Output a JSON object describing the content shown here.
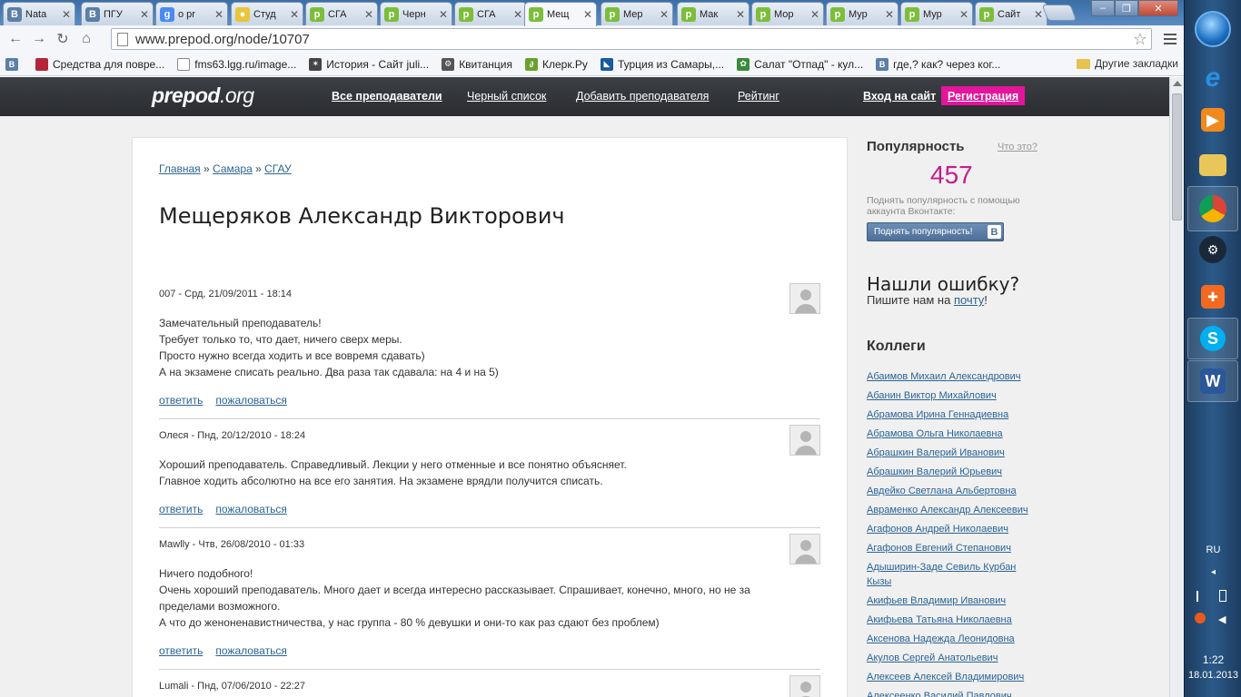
{
  "browser": {
    "tabs": [
      {
        "label": "Nata",
        "icon": "vk",
        "color": "#5b7fa6",
        "letter": "B"
      },
      {
        "label": "ПГУ",
        "icon": "vk",
        "color": "#5b7fa6",
        "letter": "B"
      },
      {
        "label": "o pr",
        "icon": "google",
        "color": "#4a8af4",
        "letter": "g"
      },
      {
        "label": "Студ",
        "icon": "bulb",
        "color": "#e8c53a",
        "letter": "●"
      },
      {
        "label": "СГА",
        "icon": "prepod",
        "color": "#7cbe3a",
        "letter": "p"
      },
      {
        "label": "Черн",
        "icon": "prepod",
        "color": "#7cbe3a",
        "letter": "p"
      },
      {
        "label": "СГА",
        "icon": "prepod",
        "color": "#7cbe3a",
        "letter": "p"
      },
      {
        "label": "Мещ",
        "icon": "prepod",
        "color": "#7cbe3a",
        "letter": "p",
        "active": true
      },
      {
        "label": "Мер",
        "icon": "prepod",
        "color": "#7cbe3a",
        "letter": "p"
      },
      {
        "label": "Мак",
        "icon": "prepod",
        "color": "#7cbe3a",
        "letter": "p"
      },
      {
        "label": "Мор",
        "icon": "prepod",
        "color": "#7cbe3a",
        "letter": "p"
      },
      {
        "label": "Мур",
        "icon": "prepod",
        "color": "#7cbe3a",
        "letter": "p"
      },
      {
        "label": "Мур",
        "icon": "prepod",
        "color": "#7cbe3a",
        "letter": "p"
      },
      {
        "label": "Сайт",
        "icon": "prepod",
        "color": "#7cbe3a",
        "letter": "p"
      }
    ],
    "url": "www.prepod.org/node/10707",
    "bookmarks": [
      {
        "label": "",
        "color": "#5b7fa6",
        "letter": "B"
      },
      {
        "label": "Средства для повре...",
        "color": "#b5263a",
        "letter": ""
      },
      {
        "label": "fms63.lgg.ru/image...",
        "color": "#ffffff",
        "letter": ""
      },
      {
        "label": "История - Сайт juli...",
        "color": "#444444",
        "letter": "✶"
      },
      {
        "label": "Квитанция",
        "color": "#555555",
        "letter": "⚙"
      },
      {
        "label": "Клерк.Ру",
        "color": "#6aa12d",
        "letter": "∂"
      },
      {
        "label": "Турция из Самары,...",
        "color": "#1a5aa0",
        "letter": "◣"
      },
      {
        "label": "Салат \"Отпад\" - кул...",
        "color": "#3a8a3a",
        "letter": "✿"
      },
      {
        "label": "где,? как? через ког...",
        "color": "#5b7fa6",
        "letter": "B"
      }
    ],
    "other_bookmarks": "Другие закладки"
  },
  "site": {
    "logo_main": "prepod",
    "logo_tld": ".org",
    "nav": [
      {
        "label": "Все преподаватели",
        "bold": true
      },
      {
        "label": "Черный список",
        "bold": false
      },
      {
        "label": "Добавить преподавателя",
        "bold": false
      },
      {
        "label": "Рейтинг",
        "bold": false
      }
    ],
    "login": "Вход на сайт",
    "register": "Регистрация"
  },
  "main": {
    "breadcrumb": [
      {
        "label": "Главная"
      },
      {
        "label": "Самара"
      },
      {
        "label": "СГАУ"
      }
    ],
    "breadcrumb_sep": " » ",
    "title": "Мещеряков Александр Викторович",
    "reply_label": "ответить",
    "complain_label": "пожаловаться",
    "comments": [
      {
        "meta": "007 - Срд, 21/09/2011 - 18:14",
        "lines": [
          "Замечательный преподаватель!",
          "Требует только то, что дает, ничего сверх меры.",
          "Просто нужно всегда ходить и все вовремя сдавать)",
          "А на экзамене списать реально. Два раза так сдавала: на 4 и на 5)"
        ]
      },
      {
        "meta": "Олеся - Пнд, 20/12/2010 - 18:24",
        "lines": [
          "Хороший преподаватель. Справедливый. Лекции у него отменные и все понятно объясняет.",
          "Главное ходить абсолютно на все его занятия. На экзамене врядли получится списать."
        ]
      },
      {
        "meta": "Mawlly - Чтв, 26/08/2010 - 01:33",
        "lines": [
          "Ничего подобного!",
          "Очень хороший преподаватель. Много дает и всегда интересно рассказывает. Спрашивает, конечно, много, но не за",
          "пределами возможного.",
          "А что до женоненавистничества, у нас группа - 80 % девушки и они-то как раз сдают без проблем)"
        ]
      },
      {
        "meta": "Lumali - Пнд, 07/06/2010 - 22:27",
        "lines": []
      }
    ]
  },
  "sidebar": {
    "popularity_title": "Популярность",
    "popularity_help": "Что это?",
    "popularity_count": "457",
    "popularity_desc": "Поднять популярность с помощью аккаунта Вконтакте:",
    "vk_button": "Поднять популярность!",
    "vk_letter": "B",
    "error_title": "Нашли ошибку?",
    "error_text_prefix": "Пишите нам на ",
    "error_link": "почту",
    "error_text_suffix": "!",
    "colleagues_title": "Коллеги",
    "colleagues": [
      "Абаимов Михаил Александрович",
      "Абанин Виктор Михайлович",
      "Абрамова Ирина Геннадиевна",
      "Абрамова Ольга Николаевна",
      "Абрашкин Валерий Иванович",
      "Абрашкин Валерий Юрьевич",
      "Авдейко Светлана Альбертовна",
      "Авраменко Александр Алексеевич",
      "Агафонов Андрей Николаевич",
      "Агафонов Евгений Степанович",
      "Адыширин-Заде Севиль Курбан Кызы",
      "Акифьев Владимир Иванович",
      "Акифьева Татьяна Николаевна",
      "Аксенова Надежда Леонидовна",
      "Акулов Сергей Анатольевич",
      "Алексеев Алексей Владимирович",
      "Алексеенко Василий Павлович"
    ]
  },
  "taskbar": {
    "lang": "RU",
    "time": "1:22",
    "date": "18.01.2013"
  },
  "colors": {
    "accent_pink": "#e3159a",
    "popularity_color": "#c41d8c",
    "link": "#2a6496",
    "header_bg": "#2f3236"
  }
}
